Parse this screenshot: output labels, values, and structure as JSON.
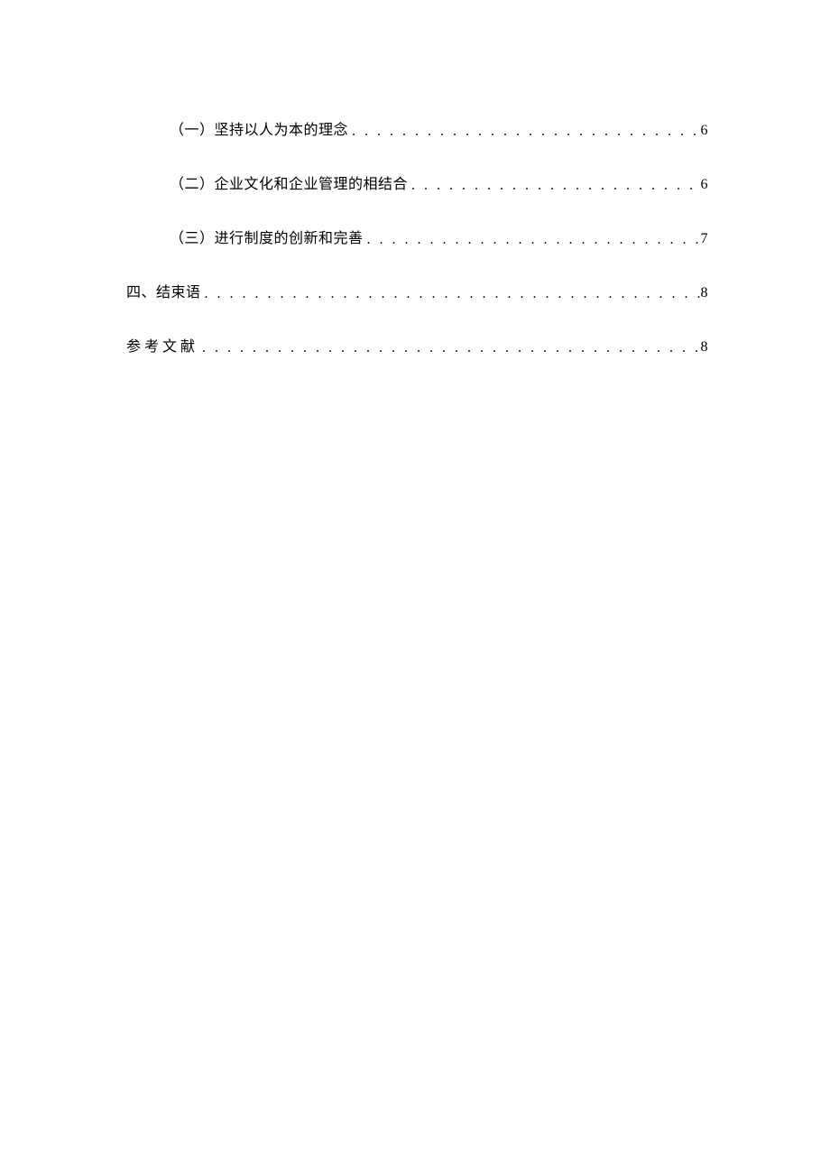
{
  "toc": {
    "entries": [
      {
        "level": 2,
        "label": "（一）坚持以人为本的理念",
        "page": "6"
      },
      {
        "level": 2,
        "label": "（二）企业文化和企业管理的相结合",
        "page": "6"
      },
      {
        "level": 2,
        "label": "（三）进行制度的创新和完善",
        "page": "7"
      },
      {
        "level": 1,
        "label": "四、结束语",
        "page": "8"
      },
      {
        "level": 1,
        "label": "参考文献",
        "page": "8"
      }
    ]
  }
}
